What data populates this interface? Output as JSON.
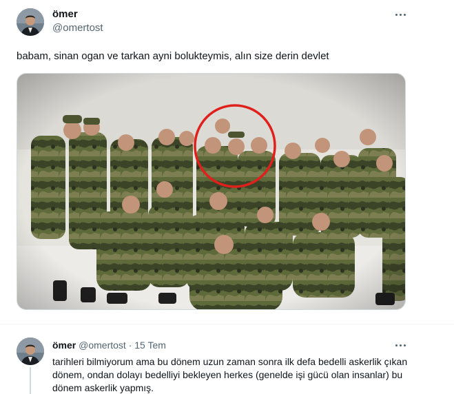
{
  "tweet": {
    "author_name": "ömer",
    "author_handle": "@omertost",
    "text": "babam, sinan ogan ve tarkan ayni bolukteymis, alın size derin devlet",
    "media_icon": "group-photo"
  },
  "reply": {
    "author_name": "ömer",
    "author_handle": "@omertost",
    "separator": "·",
    "date": "15 Tem",
    "text": "tarihleri bilmiyorum ama bu dönem uzun zaman sonra ilk defa bedelli askerlik çıkan dönem, ondan dolayı bedelliyi bekleyen herkes (genelde işi gücü olan insanlar) bu dönem askerlik yapmış."
  },
  "colors": {
    "text_primary": "#0f1419",
    "text_secondary": "#536471",
    "highlight_circle": "#e0201c",
    "camo_dark": "#3c4428",
    "camo_mid": "#5e6a3a",
    "camo_light": "#7d7e52",
    "snow": "#ecebe8"
  }
}
